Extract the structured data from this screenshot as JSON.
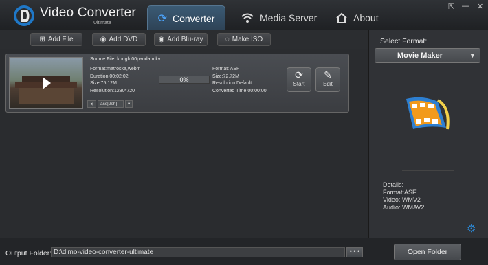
{
  "app": {
    "title": "Video Converter",
    "subtitle": "Ultimate"
  },
  "tabs": [
    {
      "label": "Converter",
      "icon": "refresh-icon",
      "active": true
    },
    {
      "label": "Media Server",
      "icon": "wifi-icon",
      "active": false
    },
    {
      "label": "About",
      "icon": "home-icon",
      "active": false
    }
  ],
  "window_controls": {
    "share": "⇱",
    "minimize": "—",
    "close": "✕"
  },
  "toolbar": {
    "add_file": "Add File",
    "add_dvd": "Add DVD",
    "add_bluray": "Add Blu-ray",
    "make_iso": "Make ISO"
  },
  "file": {
    "source_file": "Source File: kongfu00panda.mkv",
    "source": {
      "format": "Format:matroska,webm",
      "duration": "Duration:00:02:02",
      "size": "Size:75.12M",
      "resolution": "Resolution:1280*720"
    },
    "progress": "0%",
    "progress_value": 0,
    "target": {
      "format": "Format: ASF",
      "size": "Size:72.72M",
      "resolution": "Resolution:Default",
      "converted_time": "Converted Time:00:00:00"
    },
    "start_label": "Start",
    "edit_label": "Edit",
    "subtitle_value": "ass[2sh]"
  },
  "right_panel": {
    "select_format_label": "Select Format:",
    "format_value": "Movie Maker",
    "details": {
      "heading": "Details:",
      "format": "Format:ASF",
      "video": "Video: WMV2",
      "audio": "Audio: WMAV2"
    }
  },
  "bottom": {
    "output_label": "Output Folder:",
    "output_value": "D:\\dimo-video-converter-ultimate",
    "browse_label": "• • •",
    "open_folder": "Open Folder"
  },
  "colors": {
    "accent_blue": "#2b8ad9",
    "background": "#2a2c2f",
    "active_tab": "#3b5a74"
  }
}
